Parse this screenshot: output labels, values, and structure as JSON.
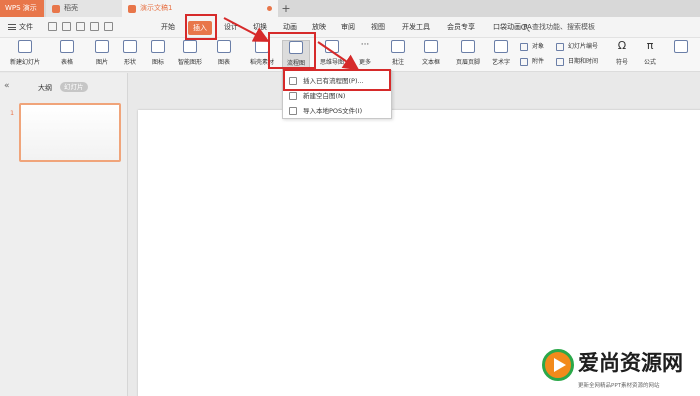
{
  "titlebar": {
    "app_name": "WPS 演示",
    "tabs": [
      {
        "label": "稻壳"
      },
      {
        "label": "演示文稿1"
      }
    ],
    "new_tab": "+"
  },
  "menubar": {
    "file": "文件",
    "items": [
      "开始",
      "插入",
      "设计",
      "切换",
      "动画",
      "放映",
      "审阅",
      "视图",
      "开发工具",
      "会员专享",
      "口袋动画 PA"
    ],
    "active": "插入",
    "search_placeholder": "查找功能、搜索模板"
  },
  "ribbon": {
    "buttons": [
      {
        "label": "新建幻灯片"
      },
      {
        "label": "表格"
      },
      {
        "label": "图片"
      },
      {
        "label": "形状"
      },
      {
        "label": "图标"
      },
      {
        "label": "智能图形"
      },
      {
        "label": "图表"
      },
      {
        "label": "稻壳素材"
      },
      {
        "label": "流程图"
      },
      {
        "label": "思维导图"
      },
      {
        "label": "更多"
      },
      {
        "label": "批注"
      },
      {
        "label": "文本框"
      },
      {
        "label": "页眉页脚"
      },
      {
        "label": "艺术字"
      },
      {
        "label": "符号"
      },
      {
        "label": "公式"
      }
    ],
    "small_buttons": [
      {
        "label": "对象"
      },
      {
        "label": "幻灯片编号"
      },
      {
        "label": "附件"
      },
      {
        "label": "日期和时间"
      }
    ]
  },
  "dropdown": {
    "items": [
      "插入已有流程图(P)...",
      "新建空白图(N)",
      "导入本地POS文件(I)"
    ]
  },
  "leftpanel": {
    "collapse": "«",
    "tab_outline": "大纲",
    "tab_slides": "幻灯片",
    "slide_number": "1"
  },
  "watermark": {
    "title": "爱尚资源网",
    "subtitle": "更新全网精品PPT素材资源的网站"
  },
  "colors": {
    "accent": "#e8764a",
    "highlight": "#d62a2a",
    "watermark_orange": "#f28a1b",
    "watermark_green": "#2ba84a"
  }
}
